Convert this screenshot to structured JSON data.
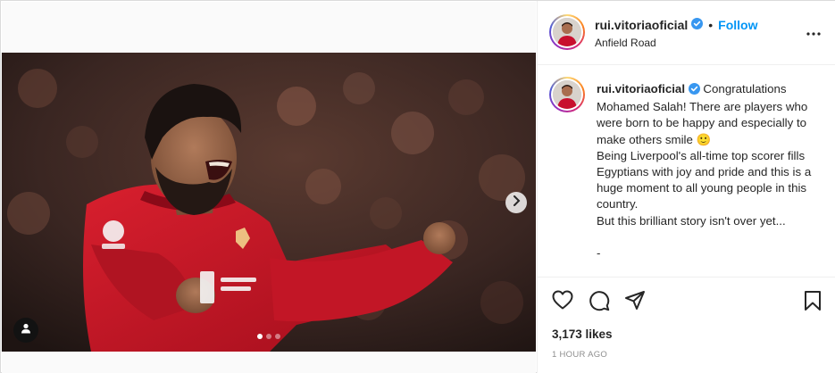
{
  "post": {
    "media_alt": "Photo of a footballer celebrating",
    "carousel": {
      "total_slides": 3,
      "active_slide": 1
    },
    "icons": {
      "next": "chevron-right-icon",
      "tags": "user-tag-icon"
    }
  },
  "header": {
    "username": "rui.vitoriaoficial",
    "separator": "•",
    "follow_label": "Follow",
    "location": "Anfield Road",
    "more_icon": "more-horizontal-icon"
  },
  "caption": {
    "username": "rui.vitoriaoficial",
    "text": "Congratulations Mohamed Salah! There are players who were born to be happy and especially to make others smile 🙂\nBeing Liverpool's all-time top scorer fills Egyptians with joy and pride and this is a huge moment to all young people in this country.\nBut this brilliant story isn't over yet...\n\n-"
  },
  "actions": {
    "like_icon": "heart-icon",
    "comment_icon": "comment-icon",
    "share_icon": "paper-plane-icon",
    "save_icon": "bookmark-icon"
  },
  "likes": "3,173 likes",
  "timestamp": "1 HOUR AGO",
  "colors": {
    "accent": "#0095f6",
    "verified": "#3897f0",
    "jersey": "#c8102e"
  }
}
